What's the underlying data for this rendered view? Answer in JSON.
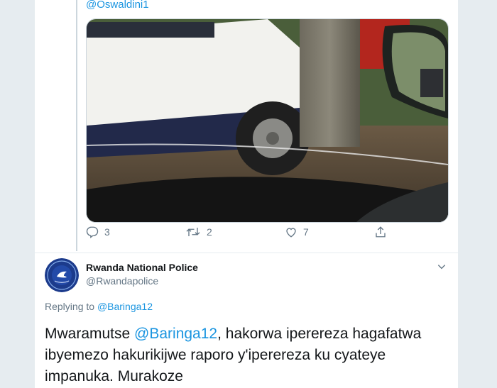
{
  "top_tweet": {
    "handle": "@Oswaldini1",
    "actions": {
      "reply_count": "3",
      "retweet_count": "2",
      "like_count": "7"
    }
  },
  "reply_tweet": {
    "display_name": "Rwanda National Police",
    "handle": "@Rwandapolice",
    "replying_to_prefix": "Replying to ",
    "replying_to_handle": "@Baringa12",
    "text_part1": "Mwaramutse ",
    "text_mention": "@Baringa12",
    "text_part2": ", hakorwa iperereza hagafatwa ibyemezo hakurikijwe raporo y'iperereza ku cyateye impanuka. Murakoze"
  },
  "colors": {
    "link_blue": "#1b95e0",
    "secondary_gray": "#657786",
    "background": "#e6ecf0"
  },
  "icons": [
    "reply-icon",
    "retweet-icon",
    "like-icon",
    "share-icon",
    "chevron-down-icon"
  ]
}
